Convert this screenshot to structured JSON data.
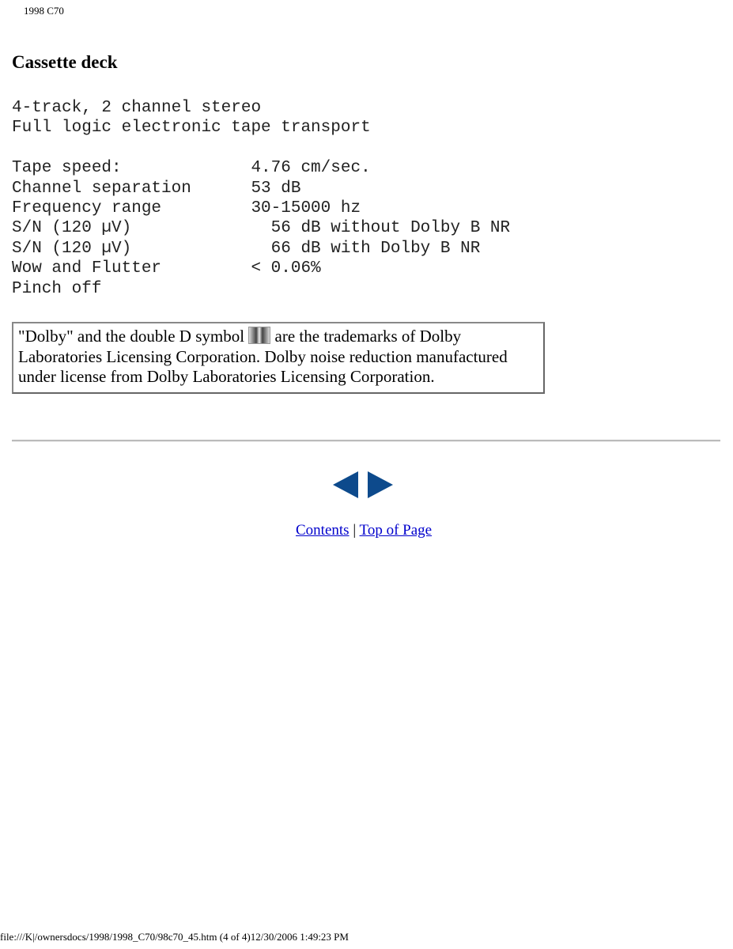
{
  "header": {
    "title": "1998 C70"
  },
  "page_title": "Cassette deck",
  "spec_lines": [
    "4-track, 2 channel stereo",
    "Full logic electronic tape transport",
    "",
    "Tape speed:             4.76 cm/sec.",
    "Channel separation      53 dB",
    "Frequency range         30-15000 hz",
    "S/N (120 µV)              56 dB without Dolby B NR",
    "S/N (120 µV)              66 dB with Dolby B NR",
    "Wow and Flutter         < 0.06%",
    "Pinch off"
  ],
  "note": {
    "before_symbol": "\"Dolby\" and the double D symbol ",
    "after_symbol": " are the trademarks of Dolby Laboratories Licensing Corporation. Dolby noise reduction manufactured under license from Dolby Laboratories Licensing Corporation.",
    "symbol_icon": "dolby-double-d-icon"
  },
  "nav": {
    "prev_icon": "triangle-left",
    "next_icon": "triangle-right",
    "arrow_color": "#0d4a8c",
    "contents": "Contents",
    "separator": "|",
    "top": "Top of Page"
  },
  "footer": "file:///K|/ownersdocs/1998/1998_C70/98c70_45.htm (4 of 4)12/30/2006 1:49:23 PM"
}
